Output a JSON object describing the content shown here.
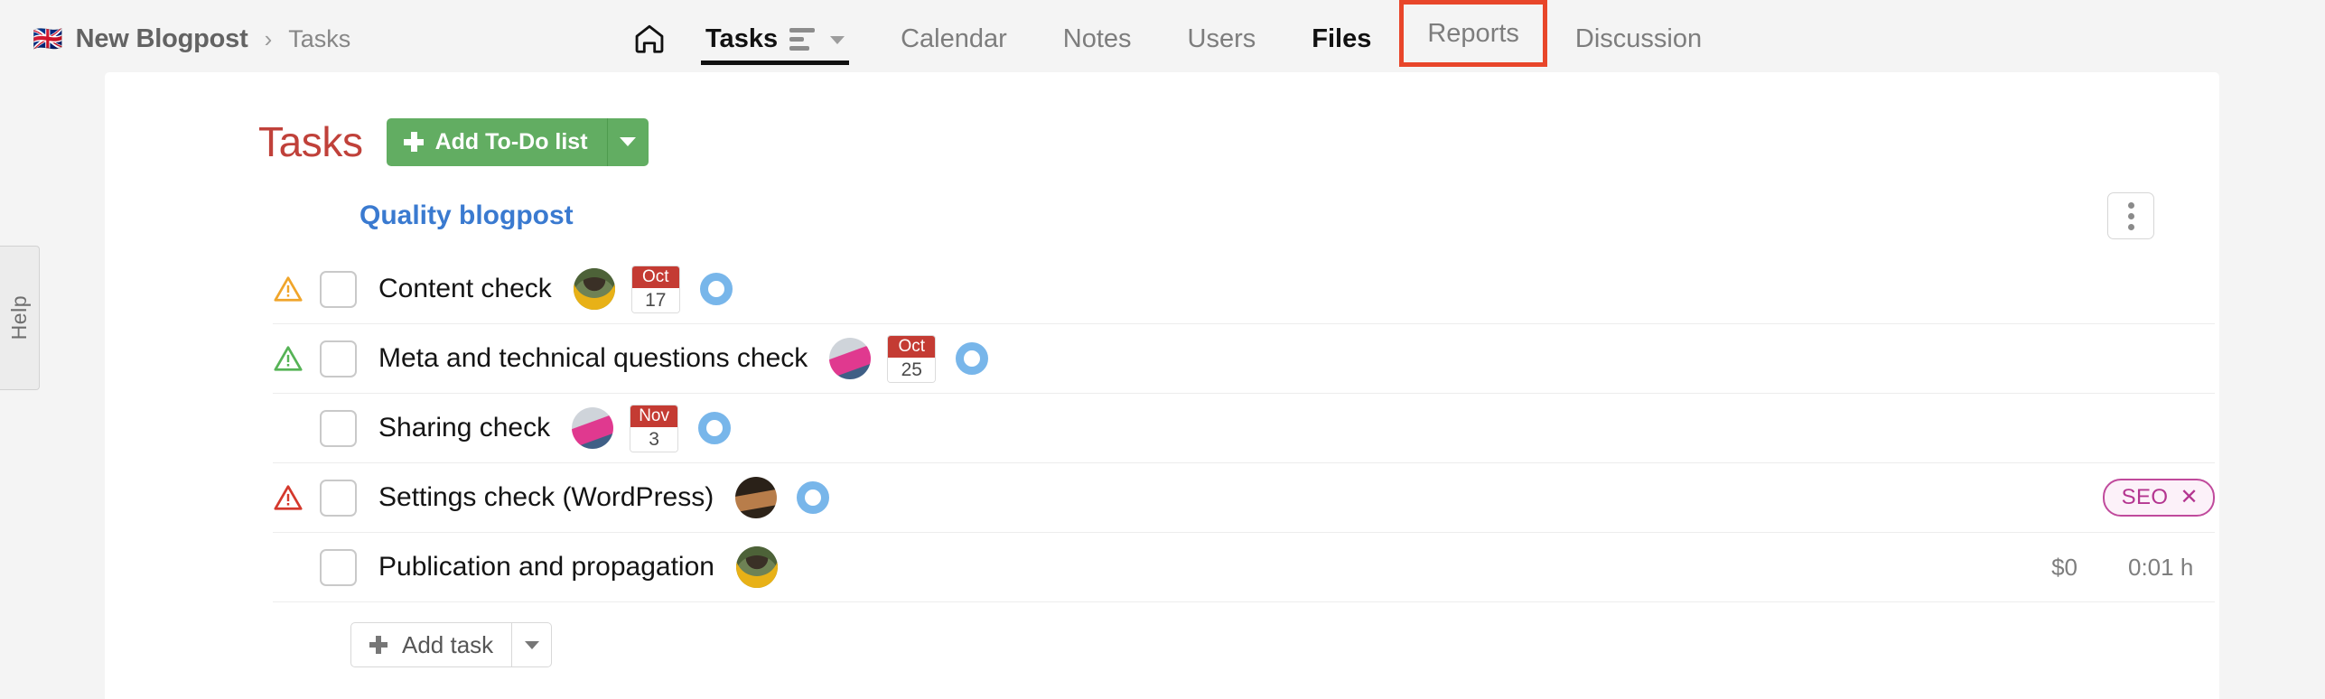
{
  "breadcrumb": {
    "flag": "🇬🇧",
    "project": "New Blogpost",
    "separator": "›",
    "current": "Tasks"
  },
  "nav": {
    "home_icon": "home-icon",
    "items": [
      {
        "label": "Tasks",
        "state": "active",
        "has_view_icon": true
      },
      {
        "label": "Calendar",
        "state": "normal",
        "has_view_icon": false
      },
      {
        "label": "Notes",
        "state": "normal",
        "has_view_icon": false
      },
      {
        "label": "Users",
        "state": "normal",
        "has_view_icon": false
      },
      {
        "label": "Files",
        "state": "semi",
        "has_view_icon": false
      },
      {
        "label": "Reports",
        "state": "highlight",
        "has_view_icon": false
      },
      {
        "label": "Discussion",
        "state": "normal",
        "has_view_icon": false
      }
    ],
    "highlight_color": "#e8462a"
  },
  "help_tab": {
    "label": "Help"
  },
  "header": {
    "title": "Tasks",
    "title_color": "#c0413a",
    "add_todo_label": "Add To-Do list",
    "add_todo_color": "#62ad62",
    "kebab_icon": "more-options-icon"
  },
  "todo_list": {
    "title": "Quality blogpost",
    "title_color": "#3a7ad0"
  },
  "tasks": [
    {
      "warning": "amber",
      "name": "Content check",
      "avatar": "av1",
      "date_month": "Oct",
      "date_day": "17",
      "has_timer": true,
      "tag": null,
      "money": null,
      "hours": null
    },
    {
      "warning": "green",
      "name": "Meta and technical questions check",
      "avatar": "av2",
      "date_month": "Oct",
      "date_day": "25",
      "has_timer": true,
      "tag": null,
      "money": null,
      "hours": null
    },
    {
      "warning": null,
      "name": "Sharing check",
      "avatar": "av2",
      "date_month": "Nov",
      "date_day": "3",
      "has_timer": true,
      "tag": null,
      "money": null,
      "hours": null
    },
    {
      "warning": "red",
      "name": "Settings check (WordPress)",
      "avatar": "av3",
      "date_month": null,
      "date_day": null,
      "has_timer": true,
      "tag": "SEO",
      "money": null,
      "hours": null
    },
    {
      "warning": null,
      "name": "Publication and propagation",
      "avatar": "av1",
      "date_month": null,
      "date_day": null,
      "has_timer": false,
      "tag": null,
      "money": "$0",
      "hours": "0:01 h"
    }
  ],
  "footer": {
    "add_task_label": "Add task"
  },
  "colors": {
    "warning_amber": "#f0a52a",
    "warning_green": "#56b356",
    "warning_red": "#d4382c",
    "timer_ring": "#78b6ea",
    "date_header": "#c43b33",
    "tag_border": "#c04a9c",
    "tag_text": "#b43590"
  }
}
